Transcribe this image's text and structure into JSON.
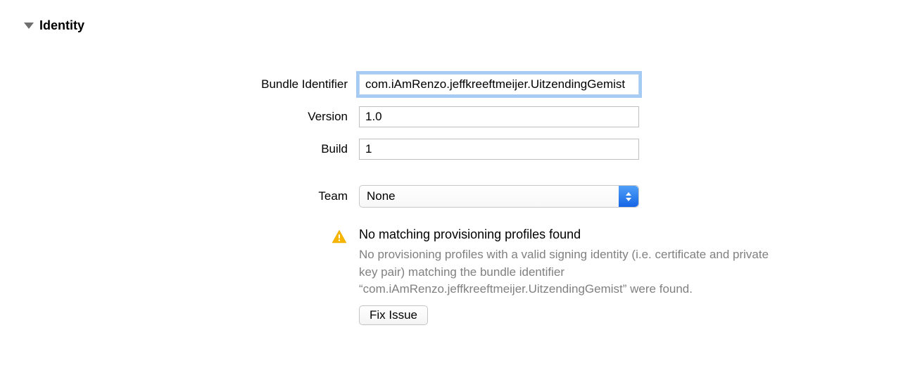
{
  "section": {
    "title": "Identity"
  },
  "fields": {
    "bundle_identifier": {
      "label": "Bundle Identifier",
      "value": "com.iAmRenzo.jeffkreeftmeijer.UitzendingGemist"
    },
    "version": {
      "label": "Version",
      "value": "1.0"
    },
    "build": {
      "label": "Build",
      "value": "1"
    },
    "team": {
      "label": "Team",
      "selected": "None"
    }
  },
  "warning": {
    "title": "No matching provisioning profiles found",
    "description": "No provisioning profiles with a valid signing identity (i.e. certificate and private key pair) matching the bundle identifier “com.iAmRenzo.jeffkreeftmeijer.UitzendingGemist” were found.",
    "fix_label": "Fix Issue"
  }
}
